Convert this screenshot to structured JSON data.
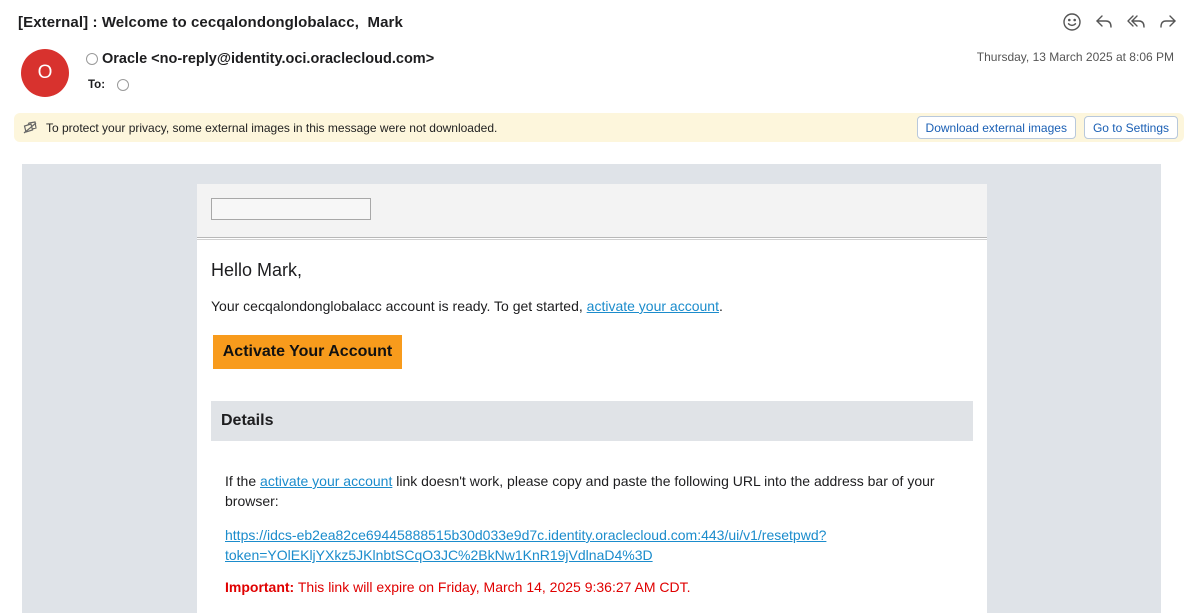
{
  "subject": "[External] : Welcome to cecqalondonglobalacc,  Mark",
  "header": {
    "avatar_letter": "O",
    "from": "Oracle <no-reply@identity.oci.oraclecloud.com>",
    "to_label": "To:",
    "date": "Thursday, 13 March 2025 at 8:06 PM",
    "actions": [
      "smiley-icon",
      "reply-icon",
      "reply-all-icon",
      "forward-icon"
    ]
  },
  "privacy": {
    "message": "To protect your privacy, some external images in this message were not downloaded.",
    "download_label": "Download external images",
    "settings_label": "Go to Settings"
  },
  "email": {
    "greeting": "Hello Mark,",
    "intro_before": "Your cecqalondonglobalacc account is ready. To get started, ",
    "intro_link": "activate your account",
    "intro_after": ".",
    "activate_button": "Activate Your Account",
    "details_heading": "Details",
    "details_before": "If the ",
    "details_link": "activate your account",
    "details_after": " link doesn't work, please copy and paste the following URL into the address bar of your browser:",
    "url_line1": "https://idcs-eb2ea82ce69445888515b30d033e9d7c.identity.oraclecloud.com:443/ui/v1/resetpwd?",
    "url_line2": "token=YOlEKljYXkz5JKlnbtSCqO3JC%2BkNw1KnR19jVdlnaD4%3D",
    "important_label": "Important:",
    "important_text": " This link will expire on Friday, March 14, 2025 9:36:27 AM CDT."
  },
  "colors": {
    "avatar": "#d8322e",
    "activate_button": "#f89b1c",
    "link": "#1b8ccc",
    "important": "#e00000",
    "privacy_bar": "#fdf6dc"
  }
}
